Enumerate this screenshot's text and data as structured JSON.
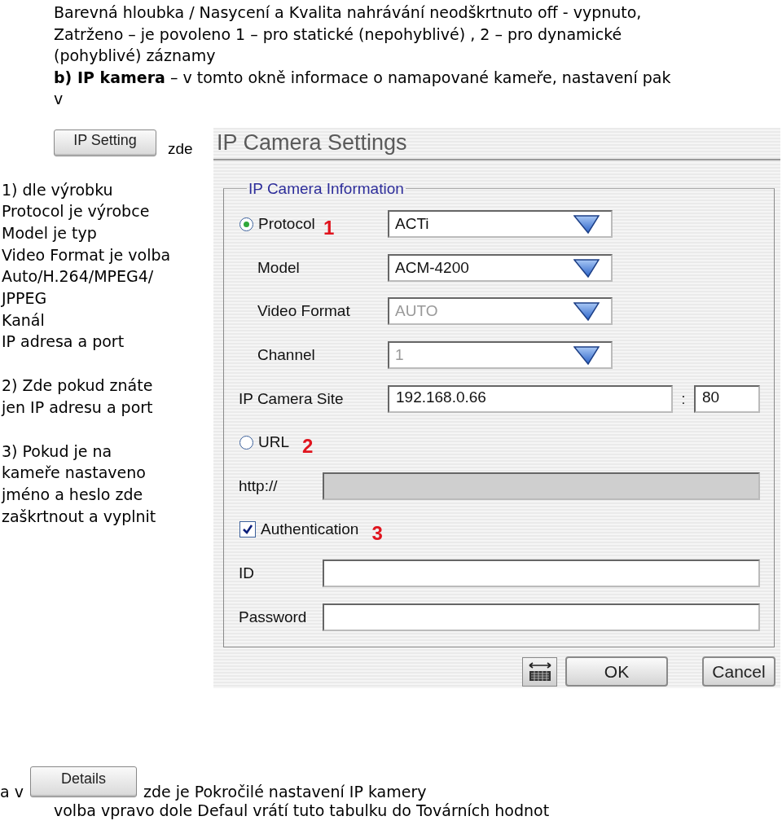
{
  "intro": {
    "lines": [
      "Barevná hloubka / Nasycení a Kvalita nahrávání neodškrtnuto off - vypnuto,",
      "Zatrženo – je povoleno 1 – pro statické (nepohyblivé) , 2 – pro dynamické",
      "(pohyblivé) záznamy",
      "**b) IP kamera** – v tomto okně informace o namapované kameře, nastavení pak",
      "v"
    ]
  },
  "ip_setting": {
    "button": "IP Setting",
    "suffix": "zde"
  },
  "notes": [
    {
      "lines": [
        "1) dle výrobku",
        "Protocol je výrobce",
        "Model je typ",
        "Video Format je volba",
        "Auto/H.264/MPEG4/",
        "JPPEG",
        "Kanál",
        "IP adresa a port"
      ]
    },
    {
      "lines": [
        "2) Zde pokud znáte",
        "jen IP adresu a port"
      ]
    },
    {
      "lines": [
        "3) Pokud je na",
        "kameře nastaveno",
        "jméno a heslo zde",
        "zaškrtnout a vyplnit"
      ]
    }
  ],
  "dialog": {
    "title": "IP Camera Settings",
    "group_label": "IP Camera Information",
    "rows": [
      {
        "kind": "dropdown",
        "label": "Protocol",
        "selected": true,
        "marker": "1",
        "value": "ACTi",
        "disabled": false
      },
      {
        "kind": "dropdown",
        "label": "Model",
        "value": "ACM-4200",
        "disabled": false
      },
      {
        "kind": "dropdown",
        "label": "Video Format",
        "value": "AUTO",
        "disabled": true
      },
      {
        "kind": "dropdown",
        "label": "Channel",
        "value": "1",
        "disabled": true
      },
      {
        "kind": "site",
        "label": "IP Camera Site",
        "value": "192.168.0.66",
        "separator": ":",
        "port": "80"
      },
      {
        "kind": "radio",
        "label": "URL",
        "selected": false,
        "marker": "2"
      },
      {
        "kind": "text",
        "label": "http://",
        "disabled": true
      },
      {
        "kind": "checkbox",
        "label": "Authentication",
        "checked": true,
        "marker": "3"
      },
      {
        "kind": "text",
        "label": "ID",
        "disabled": false
      },
      {
        "kind": "text",
        "label": "Password",
        "disabled": false
      }
    ],
    "buttons": [
      "OK",
      "Cancel"
    ]
  },
  "footer": {
    "prefix": "a v",
    "button": "Details",
    "text": "zde je Pokročilé nastavení IP kamery",
    "note": "volba vpravo dole Defaul vrátí tuto tabulku do Továrních hodnot"
  }
}
